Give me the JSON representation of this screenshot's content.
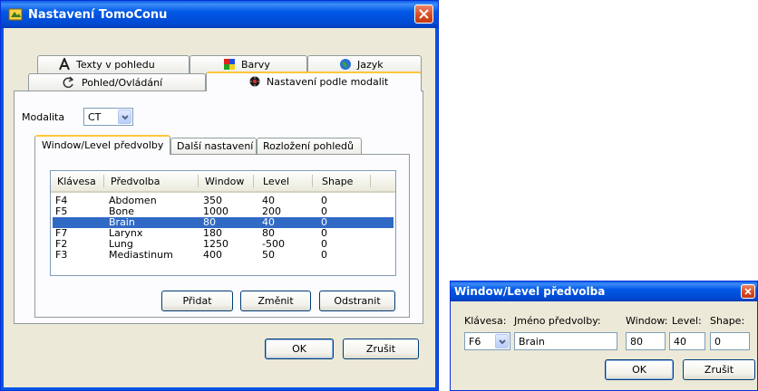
{
  "main_dialog": {
    "title": "Nastavení TomoConu",
    "tabs_back_row": [
      {
        "label": "Texty v pohledu",
        "icon": "text-font-icon"
      },
      {
        "label": "Barvy",
        "icon": "color-palette-icon"
      },
      {
        "label": "Jazyk",
        "icon": "globe-icon"
      }
    ],
    "tabs_front_row": [
      {
        "label": "Pohled/Ovládání",
        "icon": "rotate-arrow-icon"
      },
      {
        "label": "Nastavení podle modalit",
        "icon": "modality-icon"
      }
    ],
    "modality_label": "Modalita",
    "modality_value": "CT",
    "subtabs": [
      {
        "label": "Window/Level předvolby"
      },
      {
        "label": "Další nastavení"
      },
      {
        "label": "Rozložení pohledů"
      }
    ],
    "columns": [
      "Klávesa",
      "Předvolba",
      "Window",
      "Level",
      "Shape"
    ],
    "rows": [
      {
        "key": "F4",
        "preset": "Abdomen",
        "window": "350",
        "level": "40",
        "shape": "0"
      },
      {
        "key": "F5",
        "preset": "Bone",
        "window": "1000",
        "level": "200",
        "shape": "0"
      },
      {
        "key": "",
        "preset": "Brain",
        "window": "80",
        "level": "40",
        "shape": "0"
      },
      {
        "key": "F7",
        "preset": "Larynx",
        "window": "180",
        "level": "80",
        "shape": "0"
      },
      {
        "key": "F2",
        "preset": "Lung",
        "window": "1250",
        "level": "-500",
        "shape": "0"
      },
      {
        "key": "F3",
        "preset": "Mediastinum",
        "window": "400",
        "level": "50",
        "shape": "0"
      }
    ],
    "buttons": {
      "add": "Přidat",
      "change": "Změnit",
      "remove": "Odstranit",
      "ok": "OK",
      "cancel": "Zrušit"
    }
  },
  "preset_dialog": {
    "title": "Window/Level předvolba",
    "key_label": "Klávesa:",
    "name_label": "Jméno předvolby:",
    "window_label": "Window:",
    "level_label": "Level:",
    "shape_label": "Shape:",
    "key_value": "F6",
    "name_value": "Brain",
    "window_value": "80",
    "level_value": "40",
    "shape_value": "0",
    "buttons": {
      "ok": "OK",
      "cancel": "Zrušit"
    }
  }
}
